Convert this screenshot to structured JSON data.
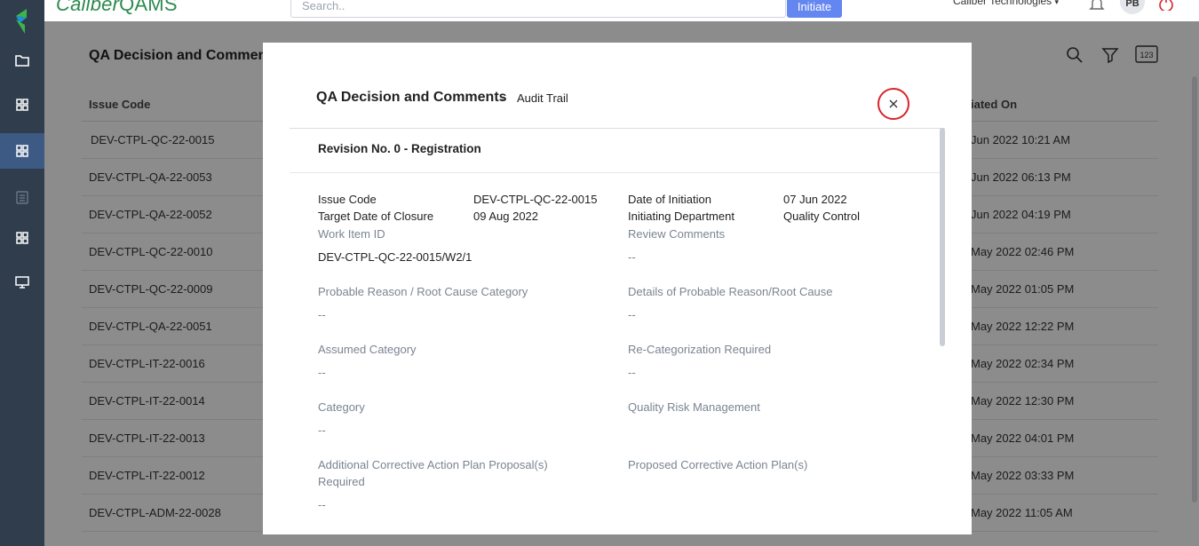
{
  "app": {
    "brand_prefix": "Caliber",
    "brand_suffix": "QAMS",
    "search_placeholder": "Search..",
    "initiate_label": "Initiate",
    "company": "Caliber Technologies",
    "avatar_initials": "PB"
  },
  "sidebar": {
    "icons": [
      "folder-icon",
      "grid-icon",
      "grid-icon",
      "clipboard-icon",
      "grid-icon",
      "monitor-icon"
    ]
  },
  "page": {
    "title": "QA Decision and Comments",
    "col_issue_code": "Issue Code",
    "col_initiated_on": "iated On",
    "rows": [
      {
        "code": "DEV-CTPL-QC-22-0015",
        "date": "Jun 2022 10:21 AM"
      },
      {
        "code": "DEV-CTPL-QA-22-0053",
        "date": "Jun 2022 06:13 PM"
      },
      {
        "code": "DEV-CTPL-QA-22-0052",
        "date": "Jun 2022 04:19 PM"
      },
      {
        "code": "DEV-CTPL-QC-22-0010",
        "date": "May 2022 02:46 PM"
      },
      {
        "code": "DEV-CTPL-QC-22-0009",
        "date": "May 2022 01:05 PM"
      },
      {
        "code": "DEV-CTPL-QA-22-0051",
        "date": "May 2022 12:22 PM"
      },
      {
        "code": "DEV-CTPL-IT-22-0016",
        "date": "May 2022 02:34 PM"
      },
      {
        "code": "DEV-CTPL-IT-22-0014",
        "date": "May 2022 12:30 PM"
      },
      {
        "code": "DEV-CTPL-IT-22-0013",
        "date": "May 2022 04:01 PM"
      },
      {
        "code": "DEV-CTPL-IT-22-0012",
        "date": "May 2022 03:33 PM"
      },
      {
        "code": "DEV-CTPL-ADM-22-0028",
        "date": "May 2022 11:05 AM"
      }
    ]
  },
  "modal": {
    "title": "QA Decision and Comments",
    "separator": "-",
    "subtitle": "Audit Trail",
    "revision": "Revision No. 0 - Registration",
    "issue_code_label": "Issue Code",
    "issue_code_value": "DEV-CTPL-QC-22-0015",
    "date_of_initiation_label": "Date of Initiation",
    "date_of_initiation_value": "07 Jun 2022",
    "target_date_label": "Target Date of Closure",
    "target_date_value": "09 Aug 2022",
    "initiating_dept_label": "Initiating Department",
    "initiating_dept_value": "Quality Control",
    "work_item_label": "Work Item ID",
    "work_item_value": "DEV-CTPL-QC-22-0015/W2/1",
    "review_comments_label": "Review Comments",
    "review_comments_value": "--",
    "probable_reason_label": "Probable Reason / Root Cause Category",
    "probable_reason_value": "--",
    "details_probable_label": "Details of Probable Reason/Root Cause",
    "details_probable_value": "--",
    "assumed_category_label": "Assumed Category",
    "assumed_category_value": "--",
    "recategorization_label": "Re-Categorization Required",
    "recategorization_value": "--",
    "category_label": "Category",
    "category_value": "--",
    "qrm_label": "Quality Risk Management",
    "additional_capa_label_1": "Additional Corrective Action Plan Proposal(s)",
    "additional_capa_label_2": "Required",
    "additional_capa_value": "--",
    "proposed_capa_label": "Proposed Corrective Action Plan(s)"
  }
}
